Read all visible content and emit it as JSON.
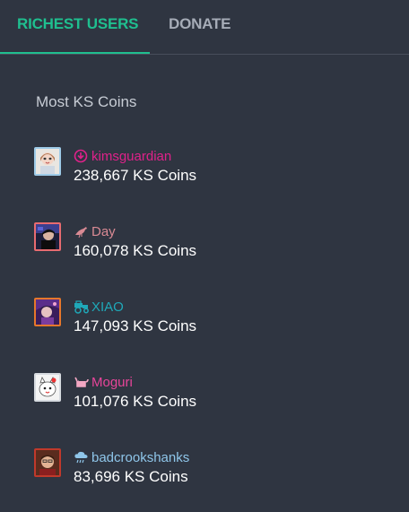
{
  "tabs": [
    {
      "label": "RICHEST USERS",
      "active": true
    },
    {
      "label": "DONATE",
      "active": false
    }
  ],
  "section_title": "Most KS Coins",
  "users": [
    {
      "name": "kimsguardian",
      "coins": "238,667 KS Coins",
      "name_color": "#e0218a",
      "badge_icon": "circle-down-arrow-icon",
      "avatar_border": "#9ecbe8"
    },
    {
      "name": "Day",
      "coins": "160,078 KS Coins",
      "name_color": "#d98a94",
      "badge_icon": "bird-icon",
      "avatar_border": "#e76b70"
    },
    {
      "name": "XIAO",
      "coins": "147,093 KS Coins",
      "name_color": "#1fa8b8",
      "badge_icon": "tractor-icon",
      "avatar_border": "#e7772b"
    },
    {
      "name": "Moguri",
      "coins": "101,076 KS Coins",
      "name_color": "#e8459a",
      "badge_icon": "cat-icon",
      "avatar_border": "#d7dbe0"
    },
    {
      "name": "badcrookshanks",
      "coins": "83,696 KS Coins",
      "name_color": "#8fc6ea",
      "badge_icon": "rain-cloud-icon",
      "avatar_border": "#c0392b"
    }
  ],
  "colors": {
    "background": "#2f3541",
    "accent": "#1fbf8f",
    "inactive_tab": "#a6acb7"
  }
}
